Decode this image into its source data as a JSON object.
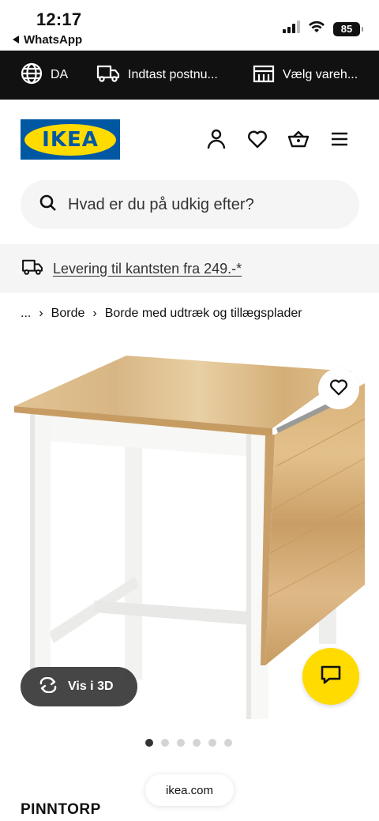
{
  "status_bar": {
    "time": "12:17",
    "back_app": "WhatsApp",
    "battery": "85"
  },
  "topbar": {
    "language": "DA",
    "postcode": "Indtast postnu...",
    "store": "Vælg vareh..."
  },
  "header": {
    "logo_text": "IKEA",
    "icons": [
      "user-icon",
      "heart-icon",
      "basket-icon",
      "menu-icon"
    ]
  },
  "search": {
    "placeholder": "Hvad er du på udkig efter?"
  },
  "delivery": {
    "text": "Levering til kantsten fra 249.-*"
  },
  "breadcrumb": {
    "items": [
      "...",
      "Borde",
      "Borde med udtræk og tillægsplader"
    ]
  },
  "product": {
    "vis3d_label": "Vis i 3D",
    "name": "PINNTORP",
    "image_count": 6,
    "active_image": 1
  },
  "browser": {
    "url": "ikea.com"
  },
  "colors": {
    "ikea_blue": "#0058a3",
    "ikea_yellow": "#ffdb00",
    "topbar_bg": "#111111"
  }
}
